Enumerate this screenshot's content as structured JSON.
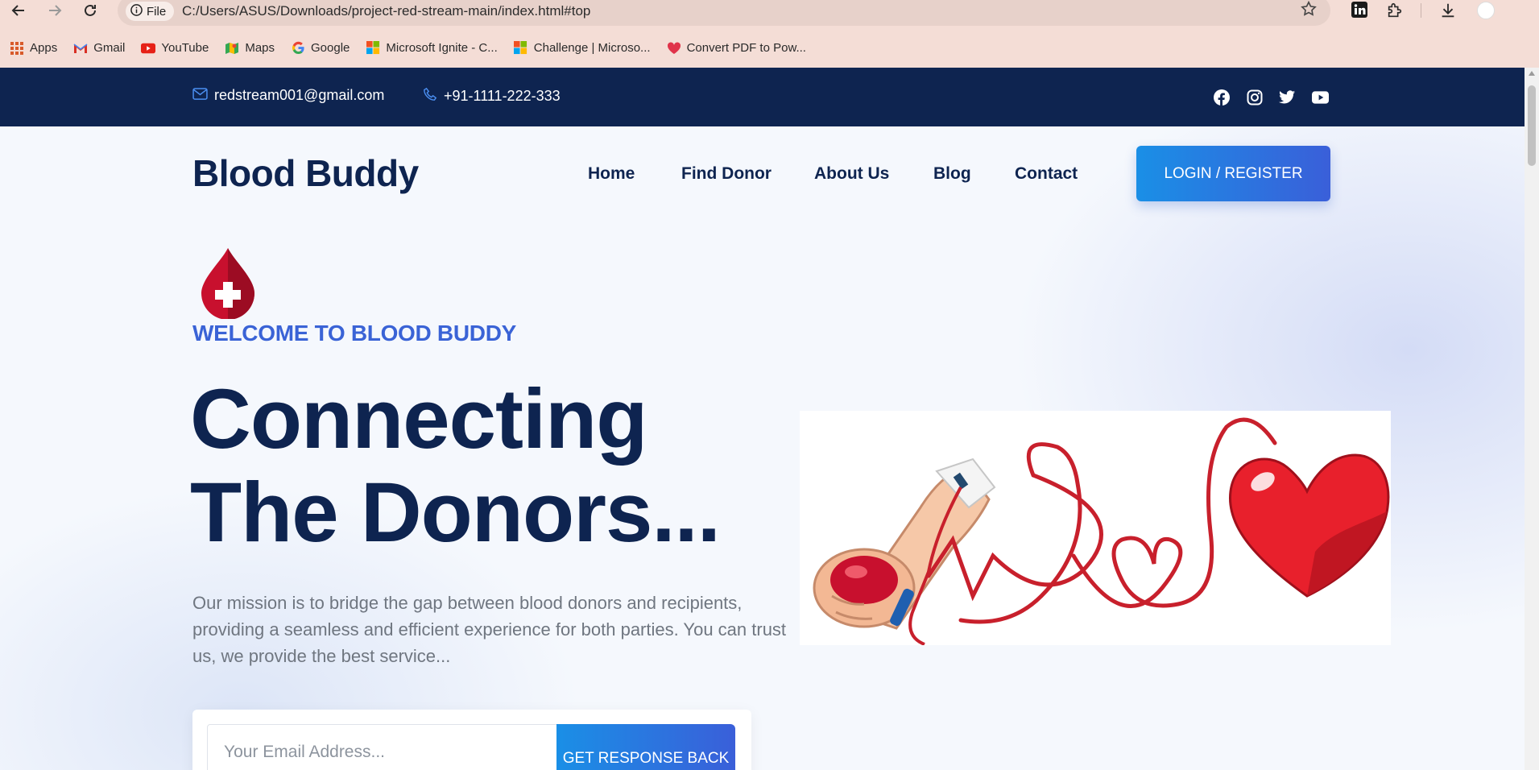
{
  "browser": {
    "chip_label": "File",
    "url": "C:/Users/ASUS/Downloads/project-red-stream-main/index.html#top",
    "bookmarks": [
      {
        "label": "Apps",
        "icon": "apps-grid-icon"
      },
      {
        "label": "Gmail",
        "icon": "gmail-icon"
      },
      {
        "label": "YouTube",
        "icon": "youtube-icon"
      },
      {
        "label": "Maps",
        "icon": "maps-icon"
      },
      {
        "label": "Google",
        "icon": "google-icon"
      },
      {
        "label": "Microsoft Ignite - C...",
        "icon": "microsoft-icon"
      },
      {
        "label": "Challenge | Microso...",
        "icon": "microsoft-icon"
      },
      {
        "label": "Convert PDF to Pow...",
        "icon": "heart-icon"
      }
    ]
  },
  "topbar": {
    "email": "redstream001@gmail.com",
    "phone": "+91-1111-222-333",
    "socials": [
      "facebook-icon",
      "instagram-icon",
      "twitter-icon",
      "youtube-icon"
    ]
  },
  "header": {
    "brand": "Blood Buddy",
    "menu": [
      "Home",
      "Find Donor",
      "About Us",
      "Blog",
      "Contact"
    ],
    "login_label": "LOGIN / REGISTER"
  },
  "hero": {
    "welcome": "WELCOME TO BLOOD BUDDY",
    "title_line1": "Connecting",
    "title_line2": "The Donors...",
    "mission": "Our mission is to bridge the gap between blood donors and recipients, providing a seamless and efficient experience for both parties. You can trust us, we provide the best service...",
    "email_placeholder": "Your Email Address...",
    "cta_label": "GET RESPONSE BACK"
  },
  "colors": {
    "navy": "#0e2450",
    "accent": "#3a63d6",
    "blood_red": "#d0202c",
    "chrome": "#f4ddd6"
  }
}
